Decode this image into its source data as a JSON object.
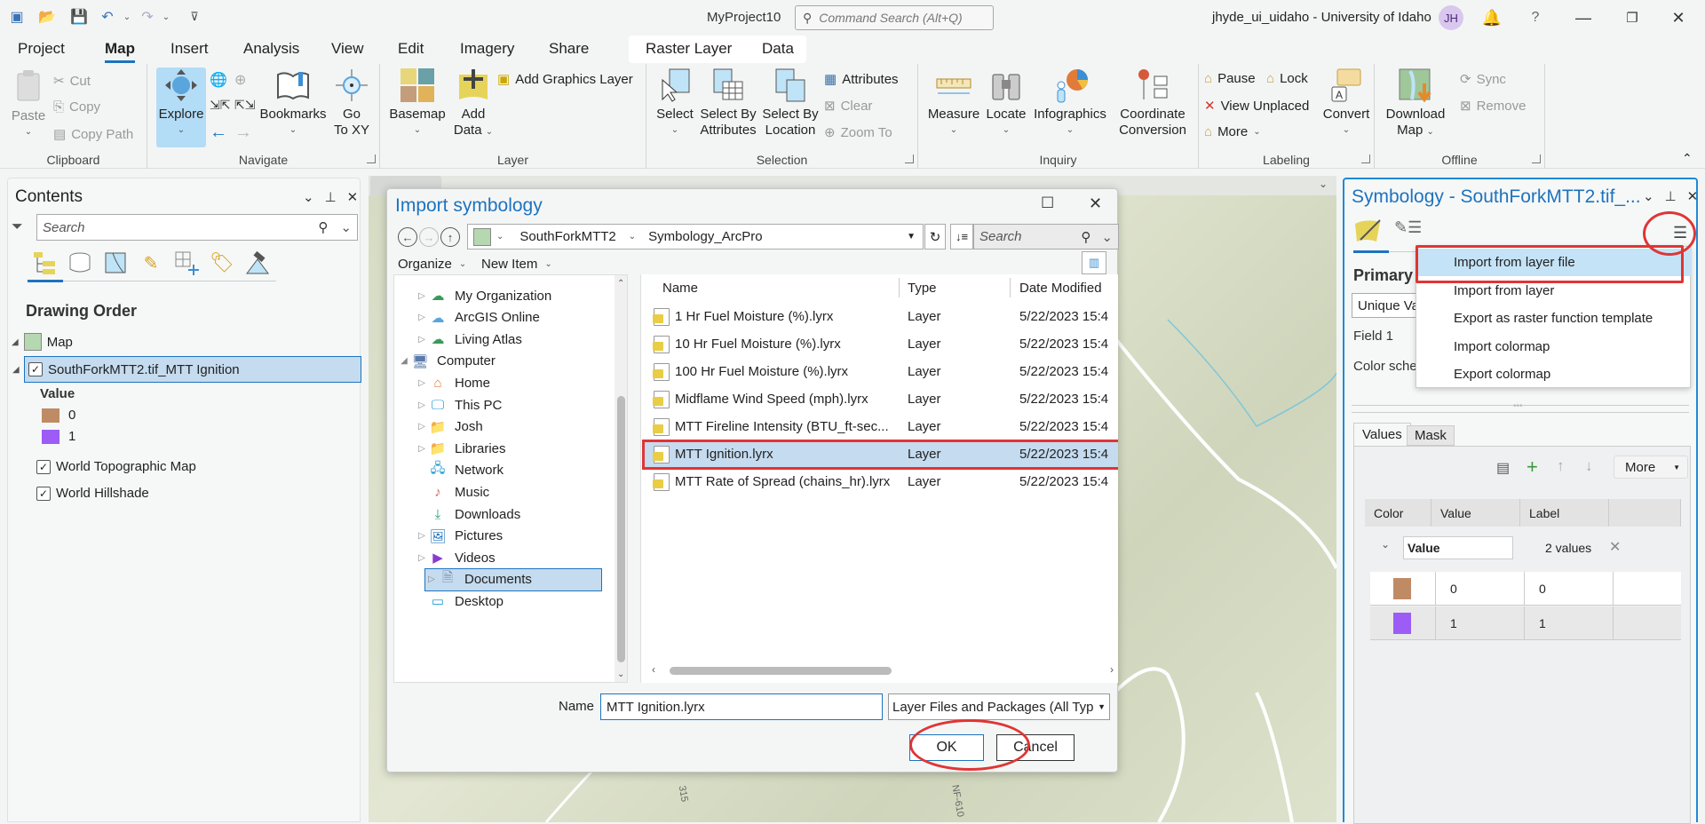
{
  "titlebar": {
    "project_name": "MyProject10",
    "command_search_placeholder": "Command Search (Alt+Q)",
    "user": "jhyde_ui_uidaho - University of Idaho",
    "avatar_initials": "JH",
    "help": "?"
  },
  "ribbon_tabs": [
    "Project",
    "Map",
    "Insert",
    "Analysis",
    "View",
    "Edit",
    "Imagery",
    "Share"
  ],
  "active_tab": "Map",
  "contextual_tabs": [
    "Raster Layer",
    "Data"
  ],
  "ribbon": {
    "clipboard": {
      "label": "Clipboard",
      "paste": "Paste",
      "cut": "Cut",
      "copy": "Copy",
      "copy_path": "Copy Path"
    },
    "navigate": {
      "label": "Navigate",
      "explore": "Explore",
      "bookmarks": "Bookmarks",
      "go_to_xy_1": "Go",
      "go_to_xy_2": "To XY"
    },
    "layer": {
      "label": "Layer",
      "basemap": "Basemap",
      "add_data_1": "Add",
      "add_data_2": "Data",
      "add_graphics_layer": "Add Graphics Layer"
    },
    "selection": {
      "label": "Selection",
      "select": "Select",
      "select_by_attr_1": "Select By",
      "select_by_attr_2": "Attributes",
      "select_by_loc_1": "Select By",
      "select_by_loc_2": "Location",
      "attributes": "Attributes",
      "clear": "Clear",
      "zoom_to": "Zoom To"
    },
    "inquiry": {
      "label": "Inquiry",
      "measure": "Measure",
      "locate": "Locate",
      "infographics": "Infographics",
      "coord_1": "Coordinate",
      "coord_2": "Conversion"
    },
    "labeling": {
      "label": "Labeling",
      "pause": "Pause",
      "lock": "Lock",
      "view_unplaced": "View Unplaced",
      "more": "More",
      "convert": "Convert"
    },
    "offline": {
      "label": "Offline",
      "download_1": "Download",
      "download_2": "Map",
      "sync": "Sync",
      "remove": "Remove"
    }
  },
  "contents": {
    "title": "Contents",
    "search_placeholder": "Search",
    "section": "Drawing Order",
    "map_label": "Map",
    "layers": [
      {
        "name": "SouthForkMTT2.tif_MTT Ignition",
        "checked": true,
        "selected": true
      },
      {
        "name": "World Topographic Map",
        "checked": true
      },
      {
        "name": "World Hillshade",
        "checked": true
      }
    ],
    "legend_heading": "Value",
    "legend": [
      {
        "label": "0",
        "color": "#bf8b65"
      },
      {
        "label": "1",
        "color": "#9c5cf5"
      }
    ]
  },
  "map": {
    "road_labels": [
      "315",
      "NF-610"
    ]
  },
  "dialog": {
    "title": "Import symbology",
    "path": [
      "SouthForkMTT2",
      "Symbology_ArcPro"
    ],
    "search_placeholder": "Search",
    "organize": "Organize",
    "new_item": "New Item",
    "nav_items": [
      {
        "label": "My Organization",
        "expandable": true
      },
      {
        "label": "ArcGIS Online",
        "expandable": true
      },
      {
        "label": "Living Atlas",
        "expandable": true
      },
      {
        "label": "Computer",
        "expanded": true
      },
      {
        "label": "Home",
        "expandable": true
      },
      {
        "label": "This PC",
        "expandable": true
      },
      {
        "label": "Josh",
        "expandable": true
      },
      {
        "label": "Libraries",
        "expandable": true
      },
      {
        "label": "Network"
      },
      {
        "label": "Music"
      },
      {
        "label": "Downloads"
      },
      {
        "label": "Pictures",
        "expandable": true
      },
      {
        "label": "Videos",
        "expandable": true
      },
      {
        "label": "Documents",
        "expandable": true,
        "selected": true
      },
      {
        "label": "Desktop"
      }
    ],
    "columns": [
      "Name",
      "Type",
      "Date Modified"
    ],
    "files": [
      {
        "name": "1 Hr Fuel Moisture (%).lyrx",
        "type": "Layer",
        "date": "5/22/2023 15:4"
      },
      {
        "name": "10 Hr Fuel Moisture (%).lyrx",
        "type": "Layer",
        "date": "5/22/2023 15:4"
      },
      {
        "name": "100 Hr Fuel Moisture (%).lyrx",
        "type": "Layer",
        "date": "5/22/2023 15:4"
      },
      {
        "name": "Midflame Wind Speed (mph).lyrx",
        "type": "Layer",
        "date": "5/22/2023 15:4"
      },
      {
        "name": "MTT Fireline Intensity (BTU_ft-sec...",
        "type": "Layer",
        "date": "5/22/2023 15:4"
      },
      {
        "name": "MTT Ignition.lyrx",
        "type": "Layer",
        "date": "5/22/2023 15:4",
        "selected": true
      },
      {
        "name": "MTT Rate of Spread (chains_hr).lyrx",
        "type": "Layer",
        "date": "5/22/2023 15:4"
      }
    ],
    "name_label": "Name",
    "name_value": "MTT Ignition.lyrx",
    "filter": "Layer Files and Packages (All Types",
    "ok": "OK",
    "cancel": "Cancel"
  },
  "symbology": {
    "title": "Symbology - SouthForkMTT2.tif_...",
    "primary_label": "Primary",
    "renderer": "Unique Val",
    "field_label": "Field 1",
    "color_scheme_label": "Color schen",
    "menu": [
      "Import from layer file",
      "Import from layer",
      "Export as raster function template",
      "Import colormap",
      "Export colormap"
    ],
    "menu_highlighted": "Import from layer file",
    "tabs": [
      "Values",
      "Mask"
    ],
    "more": "More",
    "table_headers": [
      "Color",
      "Value",
      "Label"
    ],
    "group_field": "Value",
    "group_count": "2 values",
    "rows": [
      {
        "color": "#bf8b65",
        "value": "0",
        "label": "0"
      },
      {
        "color": "#9c5cf5",
        "value": "1",
        "label": "1"
      }
    ]
  }
}
